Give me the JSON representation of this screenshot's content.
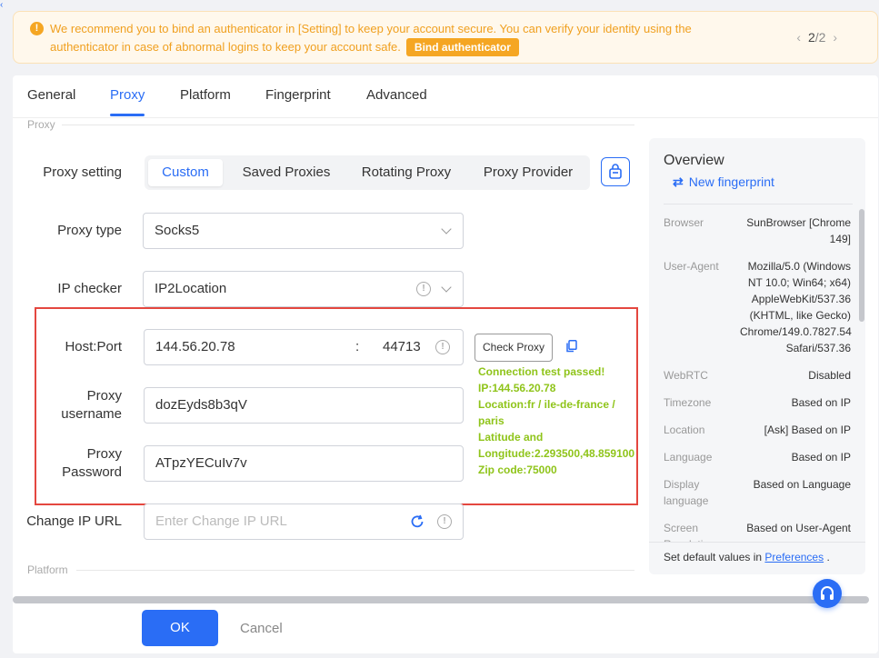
{
  "banner": {
    "message": "We recommend you to bind an authenticator in [Setting] to keep your account secure. You can verify your identity using the authenticator in case of abnormal logins to keep your account safe.",
    "bind_button": "Bind authenticator",
    "page_current": "2",
    "page_total": "/2"
  },
  "tabs": [
    "General",
    "Proxy",
    "Platform",
    "Fingerprint",
    "Advanced"
  ],
  "sections": {
    "proxy": "Proxy",
    "platform": "Platform"
  },
  "form": {
    "proxy_setting_label": "Proxy setting",
    "proxy_setting_options": [
      "Custom",
      "Saved Proxies",
      "Rotating Proxy",
      "Proxy Provider"
    ],
    "proxy_type_label": "Proxy type",
    "proxy_type_value": "Socks5",
    "ip_checker_label": "IP checker",
    "ip_checker_value": "IP2Location",
    "host_port_label": "Host:Port",
    "host_value": "144.56.20.78",
    "port_separator": ":",
    "port_value": "44713",
    "username_label_1": "Proxy",
    "username_label_2": "username",
    "username_value": "dozEyds8b3qV",
    "password_label_1": "Proxy",
    "password_label_2": "Password",
    "password_value": "ATpzYECuIv7v",
    "change_ip_label": "Change IP URL",
    "change_ip_placeholder": "Enter Change IP URL",
    "check_proxy_button": "Check Proxy"
  },
  "check_result": [
    "Connection test passed!",
    "IP:144.56.20.78",
    "Location:fr / ile-de-france /",
    "paris",
    "Latitude and",
    "Longitude:2.293500,48.859100",
    "Zip code:75000"
  ],
  "overview": {
    "title": "Overview",
    "new_fingerprint": "New fingerprint",
    "rows": [
      {
        "key": "Browser",
        "value": "SunBrowser [Chrome 149]"
      },
      {
        "key": "User-Agent",
        "value": "Mozilla/5.0 (Windows NT 10.0; Win64; x64) AppleWebKit/537.36 (KHTML, like Gecko) Chrome/149.0.7827.54 Safari/537.36"
      },
      {
        "key": "WebRTC",
        "value": "Disabled"
      },
      {
        "key": "Timezone",
        "value": "Based on IP"
      },
      {
        "key": "Location",
        "value": "[Ask] Based on IP"
      },
      {
        "key": "Language",
        "value": "Based on IP"
      },
      {
        "key": "Display language",
        "value": "Based on Language"
      },
      {
        "key": "Screen Resolution",
        "value": "Based on User-Agent"
      }
    ],
    "footer_text": "Set default values in ",
    "footer_link": "Preferences",
    "footer_end": " ."
  },
  "footer": {
    "ok": "OK",
    "cancel": "Cancel"
  },
  "colors": {
    "accent": "#2a6df5",
    "warning": "#f5a623",
    "success": "#8fc41a",
    "highlight_frame": "#e4473f"
  }
}
